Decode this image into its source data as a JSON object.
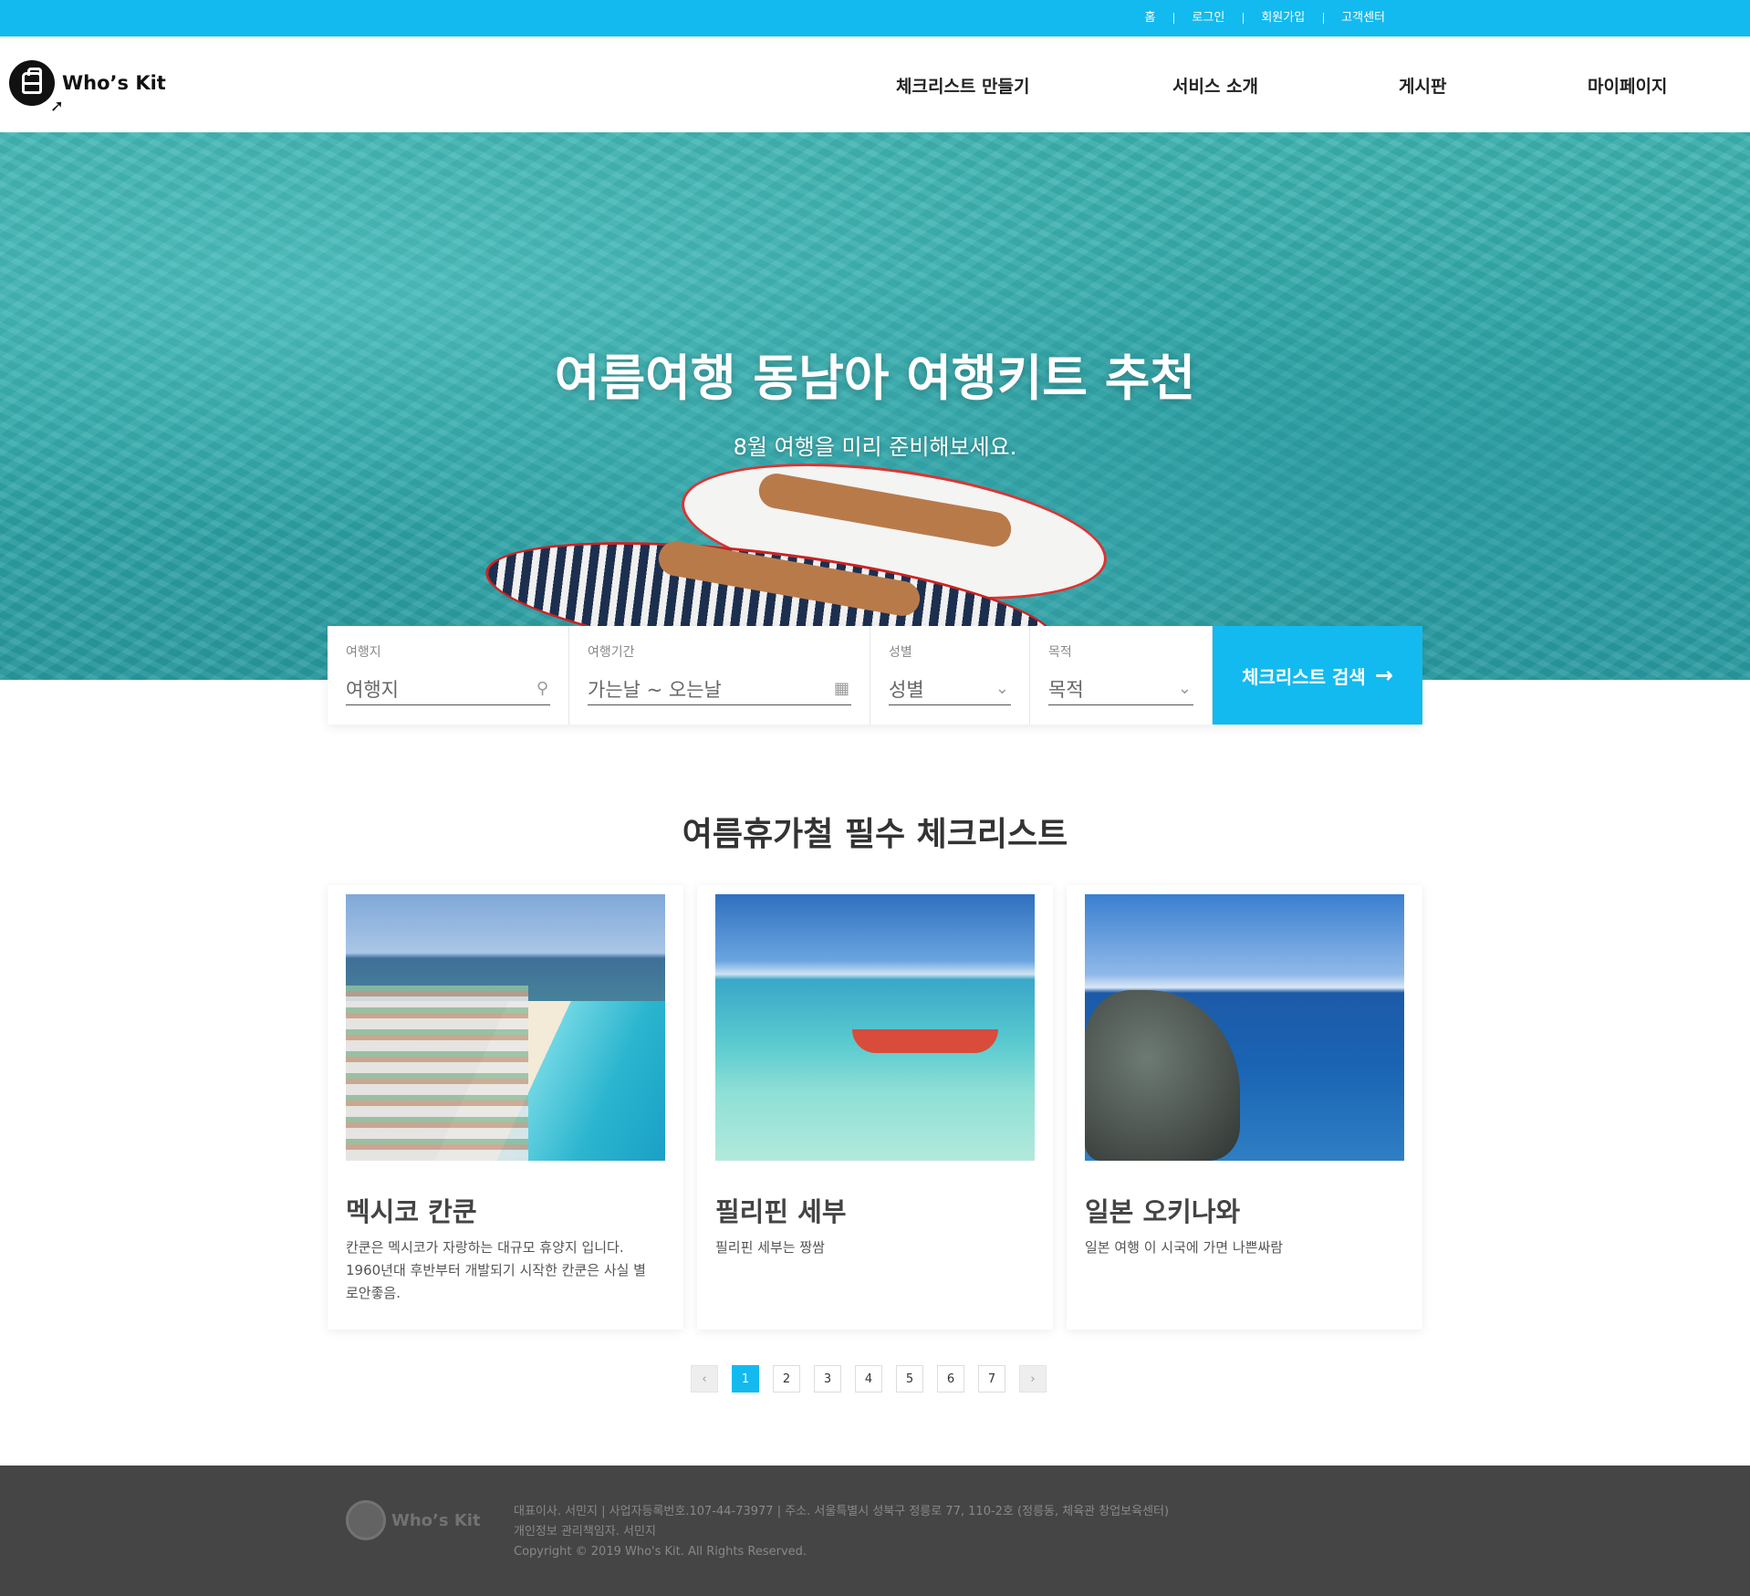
{
  "topbar": {
    "links": [
      "홈",
      "로그인",
      "회원가입",
      "고객센터"
    ]
  },
  "header": {
    "logo_text": "Who’s Kit",
    "nav": [
      "체크리스트 만들기",
      "서비스 소개",
      "게시판",
      "마이페이지"
    ]
  },
  "hero": {
    "title": "여름여행 동남아 여행키트 추천",
    "subtitle": "8월 여행을 미리 준비해보세요."
  },
  "search": {
    "fields": [
      {
        "label": "여행지",
        "value": "여행지",
        "icon": "search-icon"
      },
      {
        "label": "여행기간",
        "value": "가는날 ~ 오는날",
        "icon": "calendar-icon"
      },
      {
        "label": "성별",
        "value": "성별",
        "icon": "chevron-down-icon"
      },
      {
        "label": "목적",
        "value": "목적",
        "icon": "chevron-down-icon"
      }
    ],
    "button": "체크리스트 검색"
  },
  "section": {
    "title": "여름휴가철 필수 체크리스트",
    "cards": [
      {
        "title": "멕시코 칸쿤",
        "desc": "칸쿤은 멕시코가 자랑하는 대규모 휴양지 입니다. 1960년대 후반부터 개발되기 시작한 칸쿤은 사실 별로안좋음."
      },
      {
        "title": "필리핀 세부",
        "desc": "필리핀 세부는 짱쌈"
      },
      {
        "title": "일본 오키나와",
        "desc": "일본 여행 이 시국에 가면 나쁜싸람"
      }
    ]
  },
  "pagination": {
    "pages": [
      "1",
      "2",
      "3",
      "4",
      "5",
      "6",
      "7"
    ],
    "current": "1"
  },
  "footer": {
    "logo_text": "Who’s Kit",
    "line1": "대표이사. 서민지 | 사업자등록번호.107-44-73977 | 주소. 서울특별시 성북구 정릉로 77, 110-2호 (정릉동, 체육관 창업보육센터)",
    "line2": "개인정보 관리책임자. 서민지",
    "line3": "Copyright © 2019 Who's Kit. All Rights Reserved."
  },
  "colors": {
    "accent": "#13baef",
    "footer_bg": "#454545"
  }
}
